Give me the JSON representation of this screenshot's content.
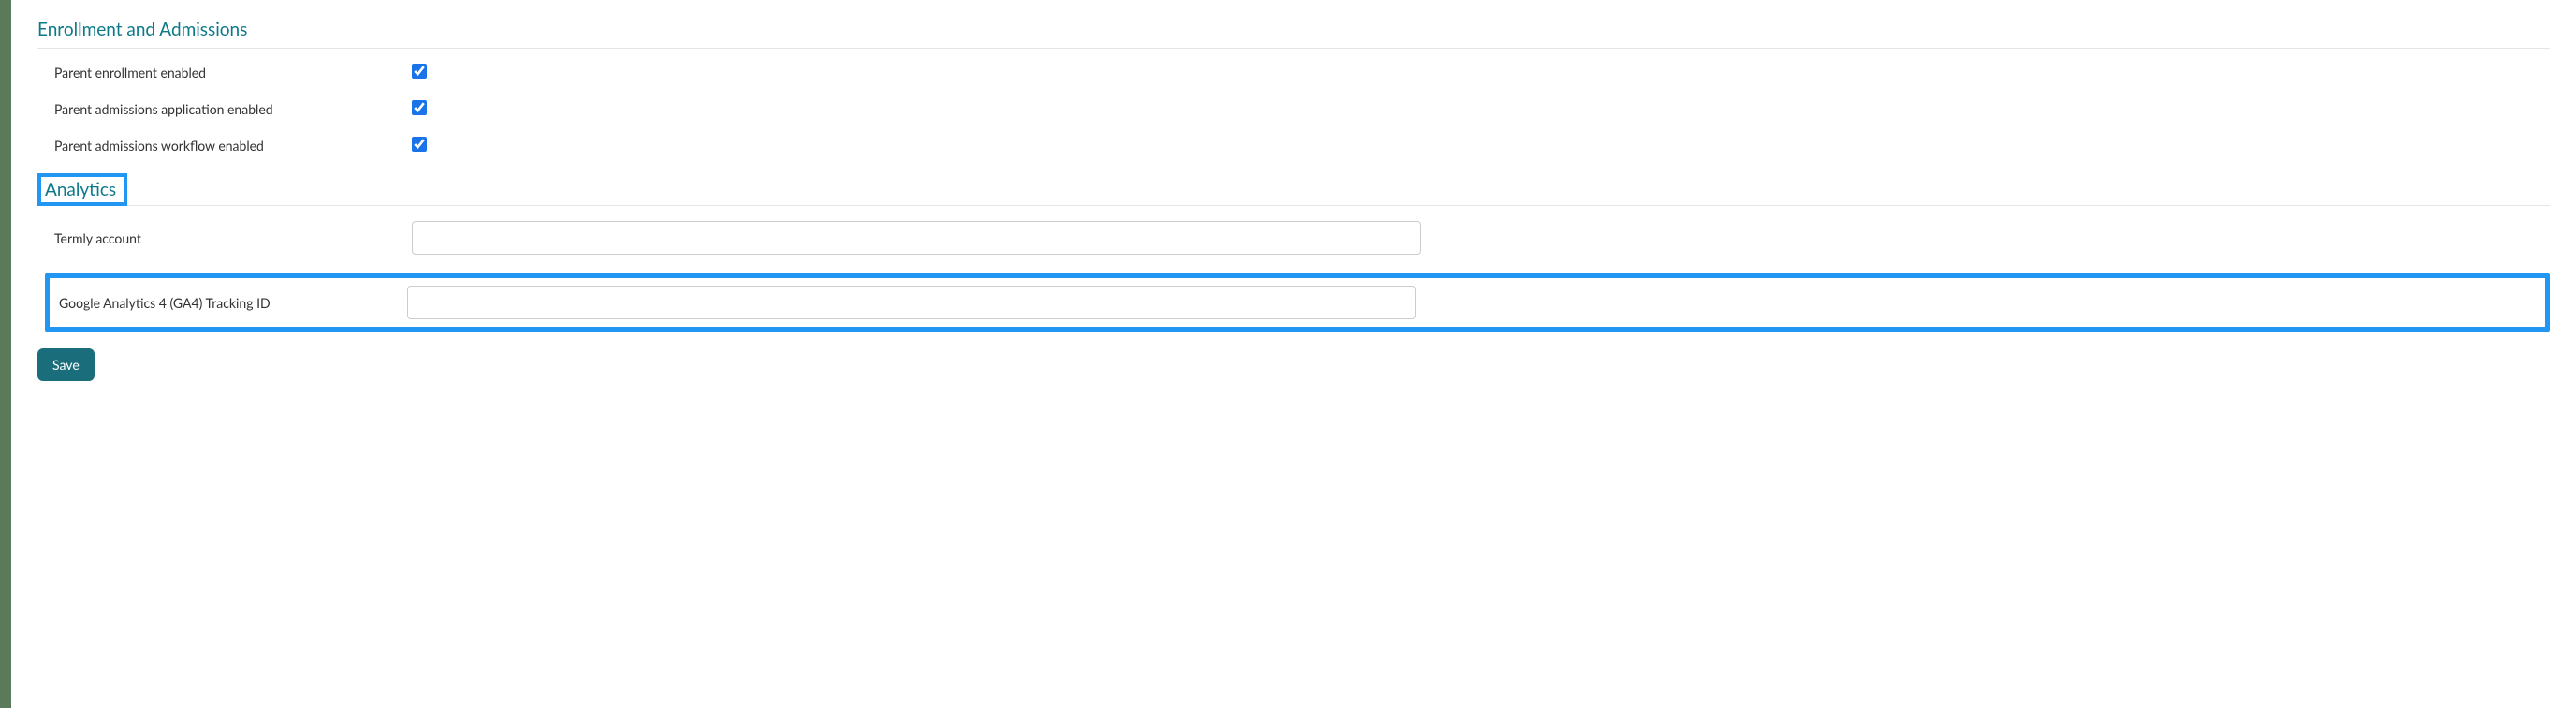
{
  "sections": {
    "enrollment": {
      "title": "Enrollment and Admissions",
      "rows": [
        {
          "label": "Parent enrollment enabled",
          "checked": true
        },
        {
          "label": "Parent admissions application enabled",
          "checked": true
        },
        {
          "label": "Parent admissions workflow enabled",
          "checked": true
        }
      ]
    },
    "analytics": {
      "title": "Analytics",
      "rows": [
        {
          "label": "Termly account",
          "value": ""
        },
        {
          "label": "Google Analytics 4 (GA4) Tracking ID",
          "value": ""
        }
      ]
    }
  },
  "buttons": {
    "save": "Save"
  }
}
